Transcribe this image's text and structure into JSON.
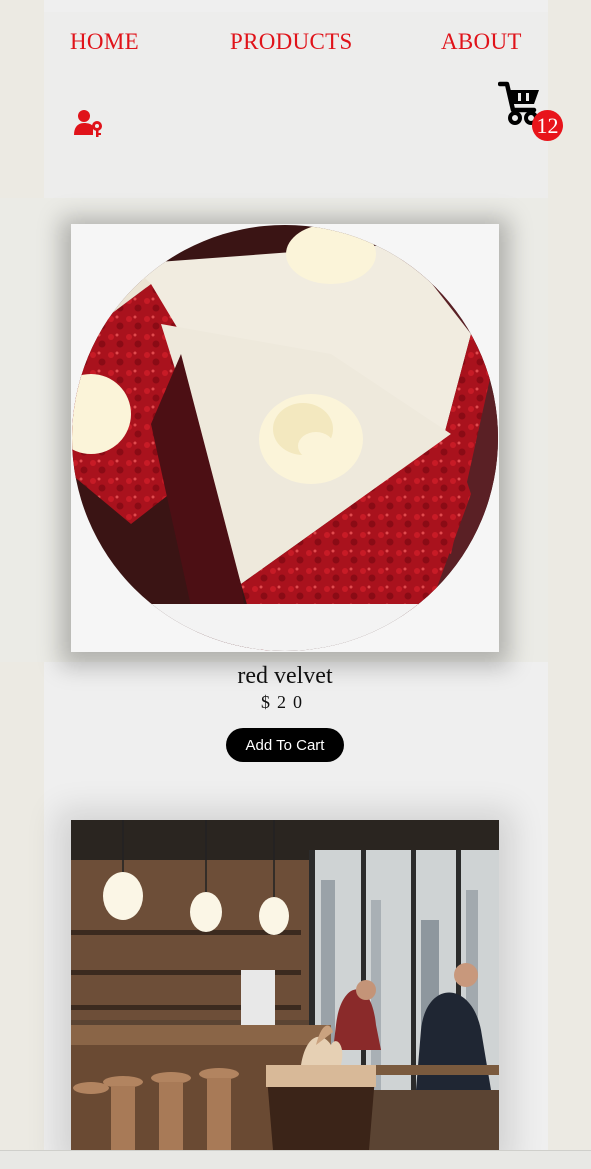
{
  "nav": {
    "home": "HOME",
    "products": "PRODUCTS",
    "about": "ABOUT"
  },
  "header": {
    "user_icon": "user-key-icon",
    "cart_icon": "shopping-cart-icon",
    "cart_count": "12"
  },
  "products": [
    {
      "image": "red-velvet-cake-image",
      "name": "red velvet",
      "price": "$20",
      "add_label": "Add To Cart"
    },
    {
      "image": "cafe-interior-coffee-image"
    }
  ],
  "colors": {
    "accent": "#e0131a",
    "button": "#000000",
    "background": "#eceae3"
  }
}
